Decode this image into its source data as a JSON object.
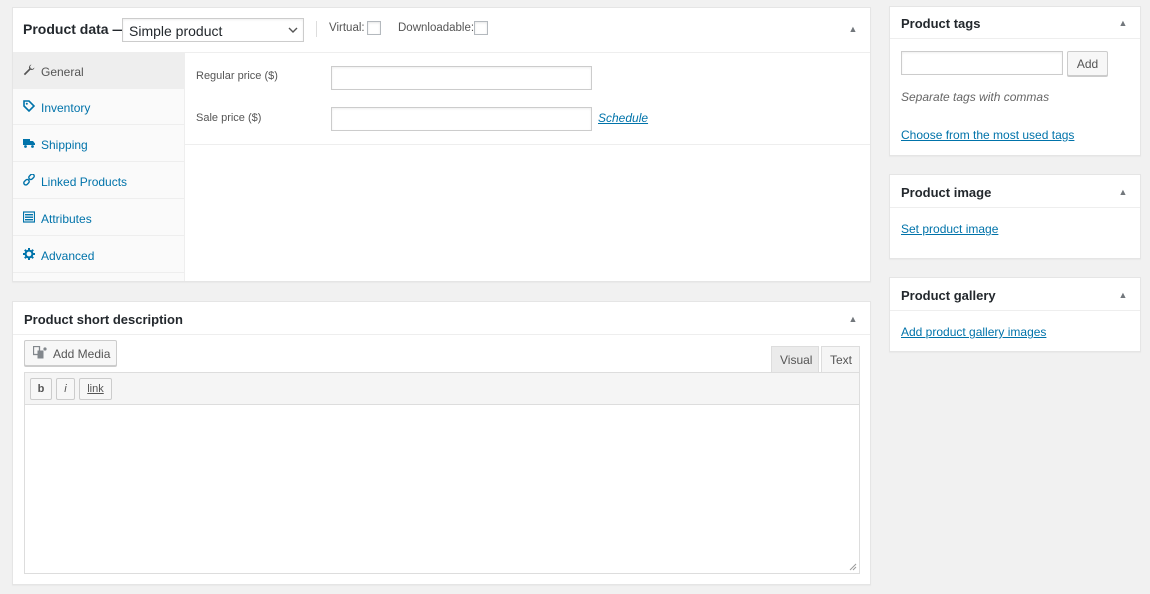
{
  "product_data": {
    "title": "Product data —",
    "product_type": "Simple product",
    "virtual_label": "Virtual:",
    "downloadable_label": "Downloadable:",
    "tabs": [
      {
        "label": "General",
        "icon": "wrench-icon"
      },
      {
        "label": "Inventory",
        "icon": "tag-icon"
      },
      {
        "label": "Shipping",
        "icon": "truck-icon"
      },
      {
        "label": "Linked Products",
        "icon": "link-icon"
      },
      {
        "label": "Attributes",
        "icon": "list-icon"
      },
      {
        "label": "Advanced",
        "icon": "gear-icon"
      }
    ],
    "regular_price_label": "Regular price ($)",
    "regular_price_value": "",
    "sale_price_label": "Sale price ($)",
    "sale_price_value": "",
    "schedule_link": "Schedule"
  },
  "short_description": {
    "title": "Product short description",
    "add_media": "Add Media",
    "tab_visual": "Visual",
    "tab_text": "Text",
    "quicktags": [
      "b",
      "i",
      "link"
    ],
    "content": ""
  },
  "product_tags": {
    "title": "Product tags",
    "input_value": "",
    "add_button": "Add",
    "hint": "Separate tags with commas",
    "most_used_link": "Choose from the most used tags"
  },
  "product_image": {
    "title": "Product image",
    "set_link": "Set product image"
  },
  "product_gallery": {
    "title": "Product gallery",
    "add_link": "Add product gallery images"
  },
  "colors": {
    "link": "#0073aa",
    "background": "#f1f1f1",
    "border": "#e5e5e5"
  }
}
